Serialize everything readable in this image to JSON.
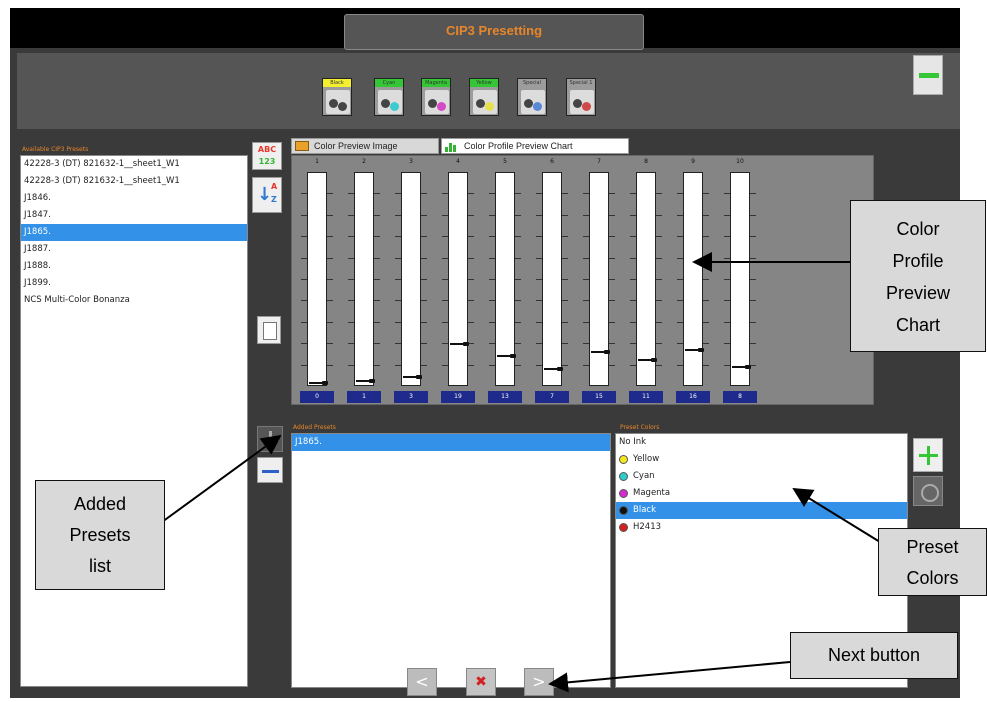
{
  "window": {
    "title": "CIP3 Presetting"
  },
  "inks": [
    {
      "label": "Black",
      "cap_color": "#f4f030",
      "dot": "#444444"
    },
    {
      "label": "Cyan",
      "cap_color": "#35c635",
      "dot": "#3ecbd0"
    },
    {
      "label": "Magenta",
      "cap_color": "#35c635",
      "dot": "#d648c8"
    },
    {
      "label": "Yellow",
      "cap_color": "#35c635",
      "dot": "#e8e04a"
    },
    {
      "label": "Special",
      "cap_color": "#9c9c9c",
      "dot": "#5a88d8"
    },
    {
      "label": "Special 1",
      "cap_color": "#9c9c9c",
      "dot": "#d04848"
    }
  ],
  "presets": {
    "header": "Available CIP3 Presets",
    "items": [
      "42228-3 (DT) 821632-1__sheet1_W1",
      "42228-3 (DT) 821632-1__sheet1_W1",
      "J1846.",
      "J1847.",
      "J1865.",
      "J1887.",
      "J1888.",
      "J1899.",
      "NCS Multi-Color Bonanza"
    ],
    "selected_index": 4
  },
  "sort_buttons": {
    "abc_top": "ABC",
    "abc_bottom": "123",
    "az_a": "A",
    "az_z": "Z"
  },
  "tabs": {
    "image": "Color Preview Image",
    "chart": "Color Profile Preview Chart"
  },
  "chart_data": {
    "type": "bar",
    "categories": [
      "1",
      "2",
      "3",
      "4",
      "5",
      "6",
      "7",
      "8",
      "9",
      "10"
    ],
    "values": [
      0,
      1,
      3,
      19,
      13,
      7,
      15,
      11,
      16,
      8
    ],
    "ylim": [
      0,
      100
    ],
    "colors": {
      "bar": "#ffffff",
      "value_bg": "#1e2a8c",
      "panel": "#858585"
    }
  },
  "added": {
    "header": "Added Presets",
    "items": [
      "J1865."
    ]
  },
  "colors": {
    "header": "Preset Colors",
    "items": [
      {
        "label": "No Ink",
        "swatch": ""
      },
      {
        "label": "Yellow",
        "swatch": "#f4e81c"
      },
      {
        "label": "Cyan",
        "swatch": "#2ecccc"
      },
      {
        "label": "Magenta",
        "swatch": "#d62ad0"
      },
      {
        "label": "Black",
        "swatch": "#111111"
      },
      {
        "label": "H2413",
        "swatch": "#d42020"
      }
    ],
    "selected_index": 4
  },
  "nav": {
    "prev": "<",
    "cancel": "✖",
    "next": ">"
  },
  "annotations": {
    "chart": [
      "Color",
      "Profile",
      "Preview",
      "Chart"
    ],
    "added": [
      "Added",
      "Presets",
      "list"
    ],
    "colors": [
      "Preset",
      "Colors"
    ],
    "next": "Next button"
  }
}
